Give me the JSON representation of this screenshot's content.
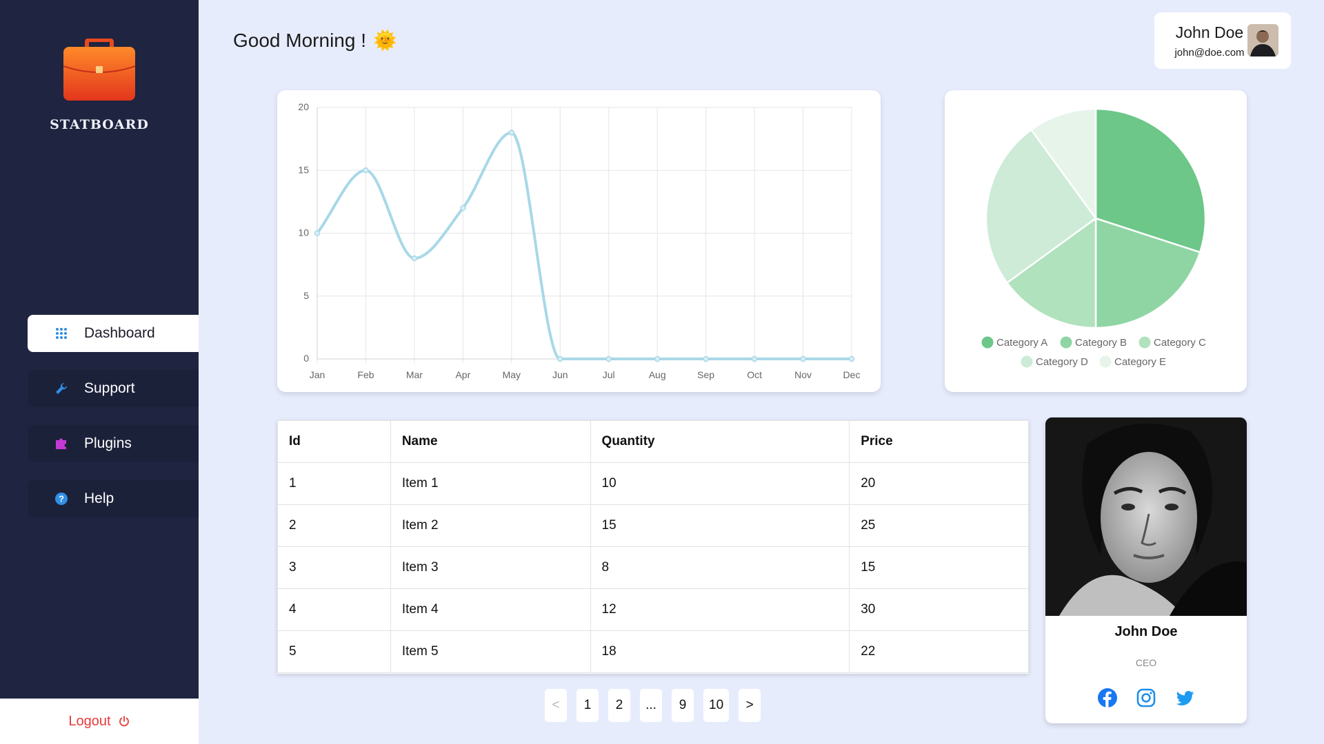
{
  "app": {
    "brand": "STATBOARD",
    "greeting": "Good Morning !",
    "greeting_emoji": "🌞"
  },
  "header": {
    "user_name": "John Doe",
    "user_email": "john@doe.com"
  },
  "sidebar": {
    "items": [
      {
        "label": "Dashboard",
        "icon": "grid-icon",
        "active": true
      },
      {
        "label": "Support",
        "icon": "wrench-icon",
        "active": false
      },
      {
        "label": "Plugins",
        "icon": "puzzle-icon",
        "active": false
      },
      {
        "label": "Help",
        "icon": "question-circle-icon",
        "active": false
      }
    ],
    "logout_label": "Logout"
  },
  "table": {
    "headers": [
      "Id",
      "Name",
      "Quantity",
      "Price"
    ],
    "rows": [
      [
        "1",
        "Item 1",
        "10",
        "20"
      ],
      [
        "2",
        "Item 2",
        "15",
        "25"
      ],
      [
        "3",
        "Item 3",
        "8",
        "15"
      ],
      [
        "4",
        "Item 4",
        "12",
        "30"
      ],
      [
        "5",
        "Item 5",
        "18",
        "22"
      ]
    ]
  },
  "pagination": {
    "prev": "<",
    "pages": [
      "1",
      "2",
      "...",
      "9",
      "10"
    ],
    "next": ">"
  },
  "profile": {
    "name": "John Doe",
    "role": "CEO",
    "socials": [
      "facebook-icon",
      "instagram-icon",
      "twitter-icon"
    ]
  },
  "colors": {
    "sidebar_bg": "#1f2440",
    "page_bg": "#e7ecfd",
    "line_color": "#a8d8e8",
    "accent_blue": "#1877f2",
    "logout_red": "#e63a3a"
  },
  "chart_data": [
    {
      "type": "line",
      "categories": [
        "Jan",
        "Feb",
        "Mar",
        "Apr",
        "May",
        "Jun",
        "Jul",
        "Aug",
        "Sep",
        "Oct",
        "Nov",
        "Dec"
      ],
      "values": [
        10,
        15,
        8,
        12,
        18,
        0,
        0,
        0,
        0,
        0,
        0,
        0
      ],
      "ylim": [
        0,
        20
      ],
      "yticks": [
        0,
        5,
        10,
        15,
        20
      ],
      "grid": true,
      "color": "#a8d8e8"
    },
    {
      "type": "pie",
      "categories": [
        "Category A",
        "Category B",
        "Category C",
        "Category D",
        "Category E"
      ],
      "values": [
        30,
        20,
        15,
        25,
        10
      ],
      "colors": [
        "#6cc788",
        "#8fd5a3",
        "#b0e2bd",
        "#cdebd7",
        "#e6f4ea"
      ],
      "legend": "bottom"
    }
  ]
}
